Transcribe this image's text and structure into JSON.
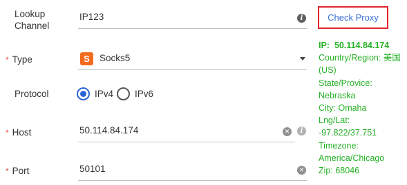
{
  "form": {
    "lookup_channel": {
      "label_line1": "Lookup",
      "label_line2": "Channel",
      "value": "IP123"
    },
    "type": {
      "required_mark": "*",
      "label": "Type",
      "icon_letter": "S",
      "value": "Socks5"
    },
    "protocol": {
      "label": "Protocol",
      "options": [
        {
          "label": "IPv4",
          "checked": true
        },
        {
          "label": "IPv6",
          "checked": false
        }
      ]
    },
    "host": {
      "required_mark": "*",
      "label": "Host",
      "value": "50.114.84.174"
    },
    "port": {
      "required_mark": "*",
      "label": "Port",
      "value": "50101"
    }
  },
  "check_button": {
    "label": "Check Proxy"
  },
  "result": {
    "ip_label": "IP:",
    "ip_value": "50.114.84.174",
    "lines": [
      "Country/Region: 美国",
      "(US)",
      "State/Provice:",
      "Nebraska",
      "City: Omaha",
      "Lng/Lat:",
      "-97.822/37.751",
      "Timezone:",
      "America/Chicago",
      "Zip: 68046"
    ]
  },
  "colors": {
    "accent": "#2c66d8",
    "required": "#e34d4d",
    "success": "#27b227",
    "highlight_border": "#e0222a",
    "socks_icon": "#f26b1d"
  }
}
